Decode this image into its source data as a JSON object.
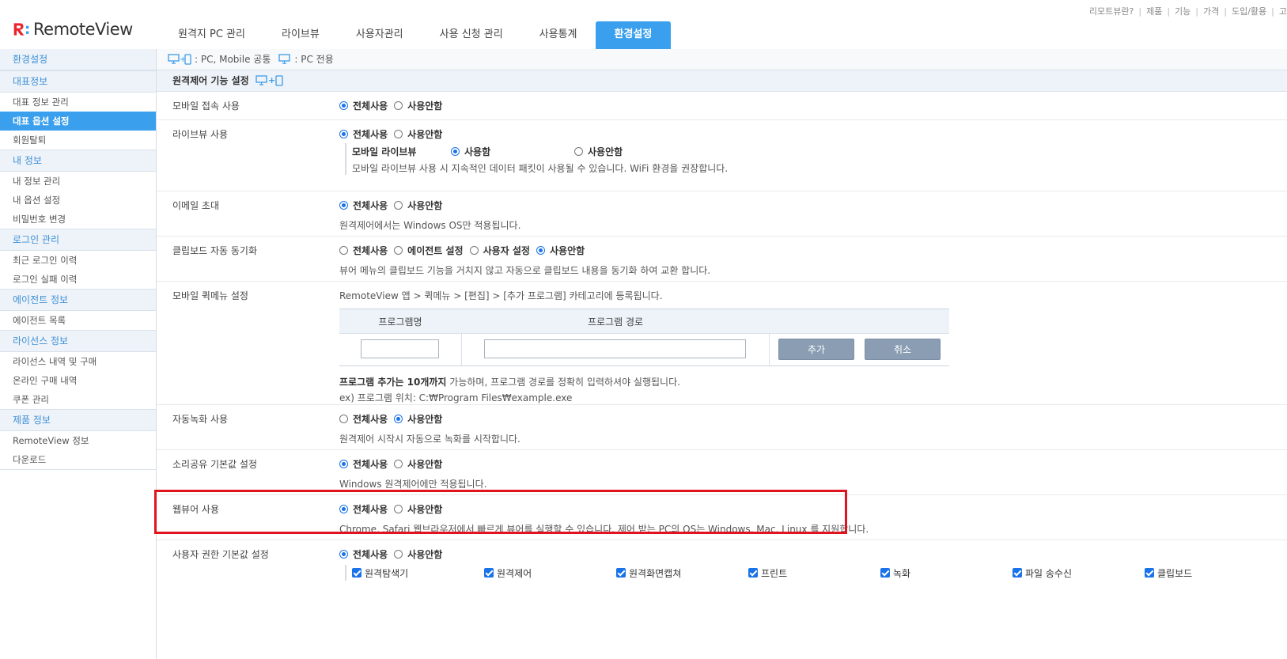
{
  "header": {
    "logo_text": "RemoteView",
    "util_links": [
      "리모트뷰란?",
      "제품",
      "기능",
      "가격",
      "도입/활용",
      "고"
    ],
    "nav_tabs": [
      "원격지 PC 관리",
      "라이브뷰",
      "사용자관리",
      "사용 신청 관리",
      "사용통계",
      "환경설정"
    ],
    "active_tab": "환경설정",
    "accent_color": "#3aa0ee"
  },
  "sidebar": {
    "groups": [
      {
        "category": "환경설정",
        "items": []
      },
      {
        "category": "대표정보",
        "items": [
          "대표 정보 관리",
          "대표 옵션 설정",
          "회원탈퇴"
        ]
      },
      {
        "category": "내 정보",
        "items": [
          "내 정보 관리",
          "내 옵션 설정",
          "비밀번호 변경"
        ]
      },
      {
        "category": "로그인 관리",
        "items": [
          "최근 로그인 이력",
          "로그인 실패 이력"
        ]
      },
      {
        "category": "에이전트 정보",
        "items": [
          "에이전트 목록"
        ]
      },
      {
        "category": "라이선스 정보",
        "items": [
          "라이선스 내역 및 구매",
          "온라인 구매 내역",
          "쿠폰 관리"
        ]
      },
      {
        "category": "제품 정보",
        "items": [
          "RemoteView 정보",
          "다운로드"
        ]
      }
    ],
    "active_item": "대표 옵션 설정"
  },
  "legend": {
    "common_label": ": PC, Mobile 공통",
    "pc_label": ": PC 전용"
  },
  "section_title": "원격제어 기능 설정",
  "options": {
    "mobile_access": {
      "label": "모바일 접속 사용",
      "choices": [
        "전체사용",
        "사용안함"
      ],
      "selected": "전체사용"
    },
    "liveview": {
      "label": "라이브뷰 사용",
      "choices": [
        "전체사용",
        "사용안함"
      ],
      "selected": "전체사용",
      "sub_label": "모바일 라이브뷰",
      "sub_choices": [
        "사용함",
        "사용안함"
      ],
      "sub_selected": "사용함",
      "desc": "모바일 라이브뷰 사용 시 지속적인 데이터 패킷이 사용될 수 있습니다. WiFi 환경을 권장합니다."
    },
    "email_invite": {
      "label": "이메일 초대",
      "choices": [
        "전체사용",
        "사용안함"
      ],
      "selected": "전체사용",
      "desc": "원격제어에서는 Windows OS만 적용됩니다."
    },
    "clipboard_sync": {
      "label": "클립보드 자동 동기화",
      "choices": [
        "전체사용",
        "에이전트 설정",
        "사용자 설정",
        "사용안함"
      ],
      "selected": "사용안함",
      "desc": "뷰어 메뉴의 클립보드 기능을 거치지 않고 자동으로 클립보드 내용을 동기화 하여 교환 합니다."
    },
    "mobile_quickmenu": {
      "label": "모바일 퀵메뉴 설정",
      "intro": "RemoteView 앱 > 퀵메뉴 > [편집] > [추가 프로그램] 카테고리에 등록됩니다.",
      "col_name": "프로그램명",
      "col_path": "프로그램 경로",
      "name_value": "",
      "path_value": "",
      "add_button": "추가",
      "cancel_button": "취소",
      "note_bold": "프로그램 추가는 10개까지",
      "note_rest": " 가능하며, 프로그램 경로를 정확히 입력하셔야 실행됩니다.",
      "example": "ex) 프로그램 위치: C:₩Program Files₩example.exe"
    },
    "auto_record": {
      "label": "자동녹화 사용",
      "choices": [
        "전체사용",
        "사용안함"
      ],
      "selected": "사용안함",
      "desc": "원격제어 시작시 자동으로 녹화를 시작합니다."
    },
    "sound_share": {
      "label": "소리공유 기본값 설정",
      "choices": [
        "전체사용",
        "사용안함"
      ],
      "selected": "전체사용",
      "desc": "Windows 원격제어에만 적용됩니다."
    },
    "webviewer": {
      "label": "웹뷰어 사용",
      "choices": [
        "전체사용",
        "사용안함"
      ],
      "selected": "전체사용",
      "desc": "Chrome, Safari 웹브라우저에서 빠르게 뷰어를 실행할 수 있습니다. 제어 받는 PC의 OS는 Windows, Mac, Linux 를 지원합니다."
    },
    "user_permission": {
      "label": "사용자 권한 기본값 설정",
      "choices": [
        "전체사용",
        "사용안함"
      ],
      "selected": "전체사용",
      "permissions": [
        "원격탐색기",
        "원격제어",
        "원격화면캡쳐",
        "프린트",
        "녹화",
        "파일 송수신",
        "클립보드"
      ],
      "all_checked": true
    }
  },
  "highlight_color": "#e0141e"
}
